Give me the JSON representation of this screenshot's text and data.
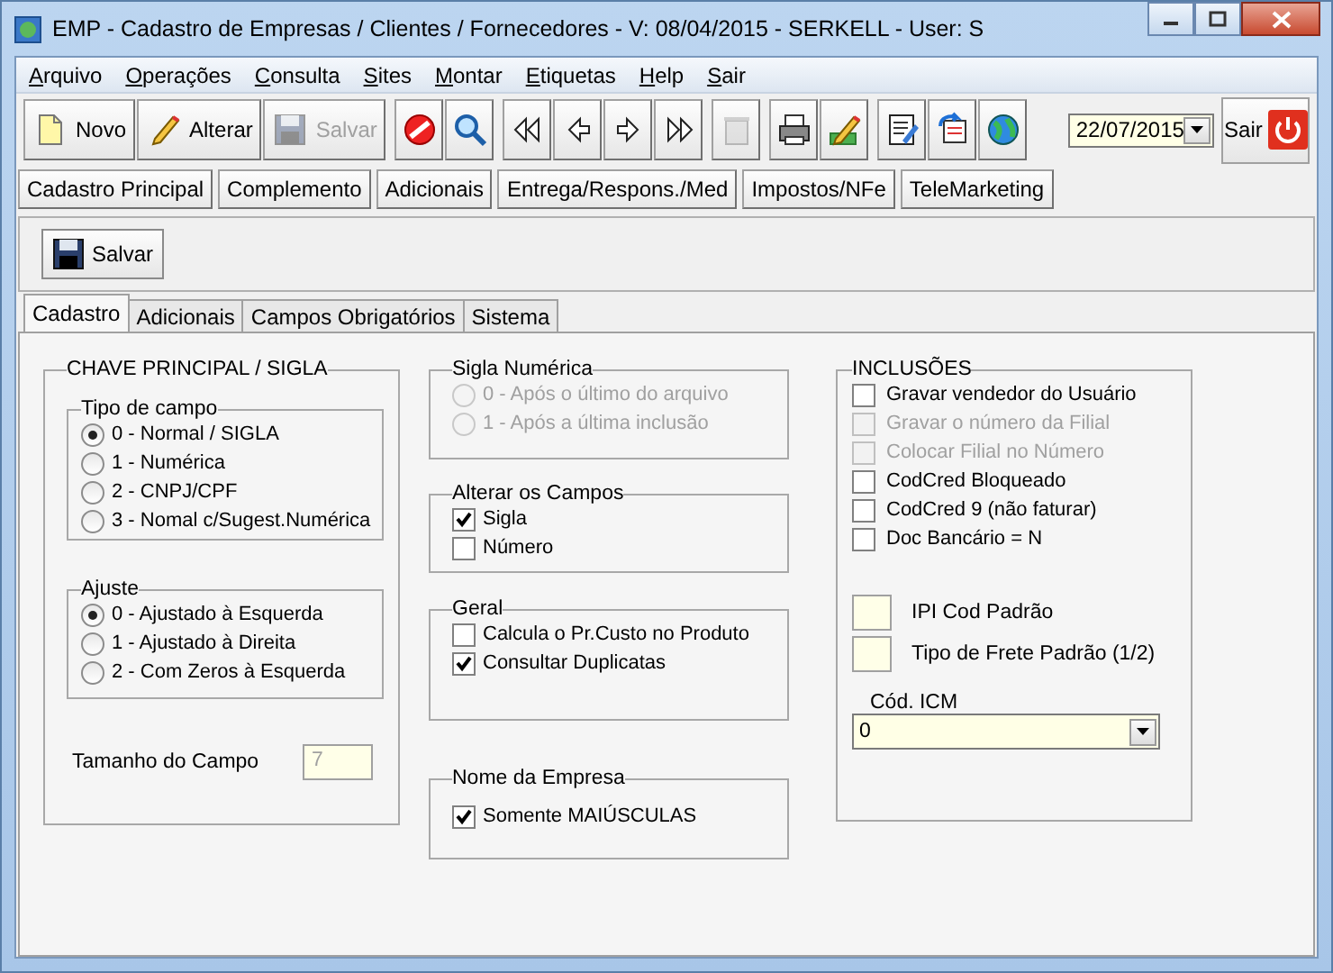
{
  "window": {
    "title": "EMP - Cadastro de Empresas / Clientes / Fornecedores - V: 08/04/2015 - SERKELL - User: S"
  },
  "menu": [
    "Arquivo",
    "Operações",
    "Consulta",
    "Sites",
    "Montar",
    "Etiquetas",
    "Help",
    "Sair"
  ],
  "toolbar": {
    "groups": [
      [
        {
          "label": "Novo",
          "disabled": false
        },
        {
          "label": "Alterar",
          "disabled": false
        },
        {
          "label": "Salvar",
          "disabled": true
        }
      ],
      [
        {
          "disabled": false
        },
        {
          "disabled": false
        }
      ],
      [
        {
          "disabled": false
        },
        {
          "disabled": false
        },
        {
          "disabled": false
        },
        {
          "disabled": false
        }
      ],
      [
        {
          "disabled": true
        }
      ],
      [
        {
          "disabled": false
        },
        {
          "disabled": false
        }
      ],
      [
        {
          "disabled": false
        },
        {
          "disabled": false
        },
        {
          "disabled": false
        }
      ]
    ],
    "date": "22/07/2015",
    "exit": "Sair"
  },
  "form_tabs": [
    "Cadastro Principal",
    "Complemento",
    "Adicionais",
    "Entrega/Respons./Med",
    "Impostos/NFe",
    "TeleMarketing"
  ],
  "save_button": "Salvar",
  "tabs": [
    {
      "label": "Cadastro",
      "selected": true
    },
    {
      "label": "Adicionais",
      "selected": false
    },
    {
      "label": "Campos Obrigatórios",
      "selected": false
    },
    {
      "label": "Sistema",
      "selected": false
    }
  ],
  "key_group": {
    "title": "CHAVE PRINCIPAL / SIGLA",
    "subgroups": [
      {
        "kind": "radio",
        "title": "Tipo de campo",
        "options": [
          {
            "label": "0 - Normal / SIGLA",
            "selected": true,
            "disabled": false
          },
          {
            "label": "1 - Numérica",
            "selected": false,
            "disabled": false
          },
          {
            "label": "2 - CNPJ/CPF",
            "selected": false,
            "disabled": false
          },
          {
            "label": "3 - Nomal c/Sugest.Numérica",
            "selected": false,
            "disabled": false
          }
        ]
      },
      {
        "kind": "radio",
        "title": "Ajuste",
        "options": [
          {
            "label": "0 - Ajustado à Esquerda",
            "selected": true,
            "disabled": false
          },
          {
            "label": "1 - Ajustado à Direita",
            "selected": false,
            "disabled": false
          },
          {
            "label": "2 - Com Zeros à Esquerda",
            "selected": false,
            "disabled": false
          }
        ]
      }
    ],
    "field_size": {
      "label": "Tamanho do Campo",
      "value": "7",
      "disabled": true
    }
  },
  "middle_groups": [
    {
      "kind": "radio",
      "title": "Sigla Numérica",
      "options": [
        {
          "label": "0 - Após o último do arquivo",
          "selected": false,
          "disabled": true
        },
        {
          "label": "1 - Após a última inclusão",
          "selected": false,
          "disabled": true
        }
      ]
    },
    {
      "kind": "checkbox",
      "title": "Alterar os Campos",
      "options": [
        {
          "label": "Sigla",
          "checked": true,
          "disabled": false
        },
        {
          "label": "Número",
          "checked": false,
          "disabled": false
        }
      ]
    },
    {
      "kind": "checkbox",
      "title": "Geral",
      "options": [
        {
          "label": "Calcula o Pr.Custo no Produto",
          "checked": false,
          "disabled": false
        },
        {
          "label": "Consultar Duplicatas",
          "checked": true,
          "disabled": false
        }
      ]
    },
    {
      "kind": "checkbox",
      "title": "Nome da Empresa",
      "options": [
        {
          "label": "Somente MAIÚSCULAS",
          "checked": true,
          "disabled": false
        }
      ]
    }
  ],
  "inclusions": {
    "title": "INCLUSÕES",
    "options": [
      {
        "label": "Gravar vendedor do Usuário",
        "checked": false,
        "disabled": false
      },
      {
        "label": "Gravar o número da Filial",
        "checked": false,
        "disabled": true
      },
      {
        "label": "Colocar Filial no Número",
        "checked": false,
        "disabled": true
      },
      {
        "label": "CodCred Bloqueado",
        "checked": false,
        "disabled": false
      },
      {
        "label": "CodCred 9 (não faturar)",
        "checked": false,
        "disabled": false
      },
      {
        "label": "Doc Bancário = N",
        "checked": false,
        "disabled": false
      }
    ],
    "fields": [
      {
        "label": "IPI Cod Padrão"
      },
      {
        "label": "Tipo de Frete Padrão (1/2)"
      }
    ],
    "icm": {
      "label": "Cód. ICM",
      "value": "0"
    }
  }
}
